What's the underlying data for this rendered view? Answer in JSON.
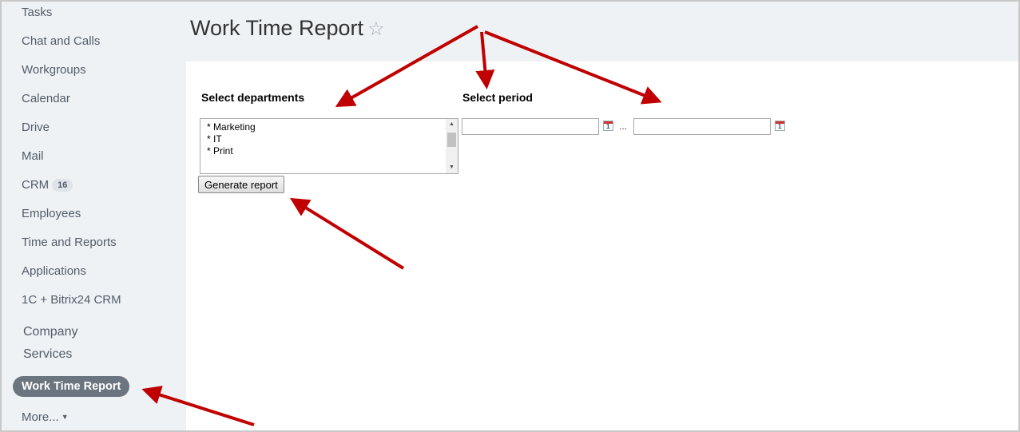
{
  "sidebar": {
    "items": [
      {
        "label": "Tasks"
      },
      {
        "label": "Chat and Calls"
      },
      {
        "label": "Workgroups"
      },
      {
        "label": "Calendar"
      },
      {
        "label": "Drive"
      },
      {
        "label": "Mail"
      },
      {
        "label": "CRM",
        "counter": "16"
      },
      {
        "label": "Employees"
      },
      {
        "label": "Time and Reports"
      },
      {
        "label": "Applications"
      },
      {
        "label": "1C + Bitrix24 CRM"
      },
      {
        "label": "Company Services"
      }
    ],
    "active_item": "Work Time Report",
    "more_label": "More..."
  },
  "header": {
    "title": "Work Time Report",
    "favorite_icon": "star-outline-icon"
  },
  "form": {
    "departments_label": "Select departments",
    "departments": [
      "* Marketing",
      "* IT",
      "* Print"
    ],
    "period_label": "Select period",
    "date_from": "",
    "date_to": "",
    "calendar_icon_text": "1",
    "period_separator": "...",
    "generate_button": "Generate report"
  },
  "annotations": {
    "arrow_color": "#c00000"
  }
}
